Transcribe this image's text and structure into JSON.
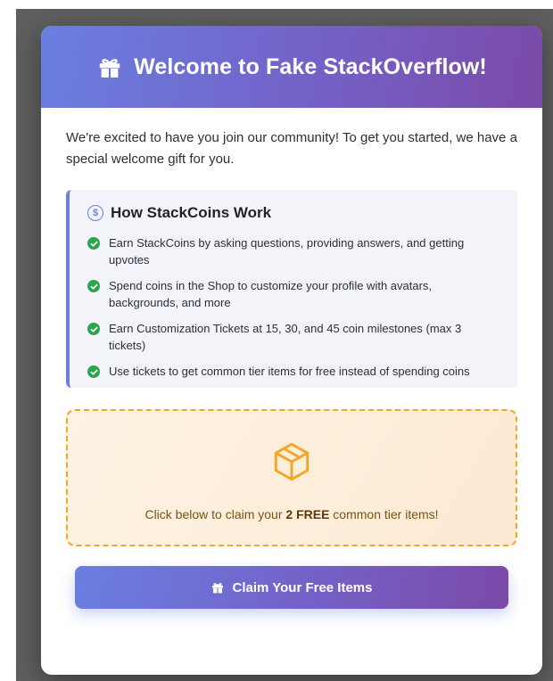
{
  "modal": {
    "title": "Welcome to Fake StackOverflow!",
    "intro": "We're excited to have you join our community! To get you started, we have a special welcome gift for you."
  },
  "info": {
    "title": "How StackCoins Work",
    "coin_glyph": "$",
    "items": [
      {
        "text": "Earn StackCoins by asking questions, providing answers, and getting upvotes"
      },
      {
        "text": "Spend coins in the Shop to customize your profile with avatars, backgrounds, and more"
      },
      {
        "text": "Earn Customization Tickets at 15, 30, and 45 coin milestones (max 3 tickets)"
      },
      {
        "text": "Use tickets to get common tier items for free instead of spending coins"
      }
    ]
  },
  "gift": {
    "text_before": "Click below to claim your ",
    "text_bold": "2 FREE",
    "text_after": " common tier items!"
  },
  "claim_button": {
    "label": "Claim Your Free Items"
  },
  "colors": {
    "accent_start": "#6a7fe0",
    "accent_end": "#7b4aa8",
    "check": "#2ea44f",
    "gift_border": "#f0a824"
  },
  "icons": {
    "header": "gift-icon",
    "info": "coin-icon",
    "item": "check-icon",
    "gift_zone": "box-icon",
    "button": "gift-icon"
  }
}
